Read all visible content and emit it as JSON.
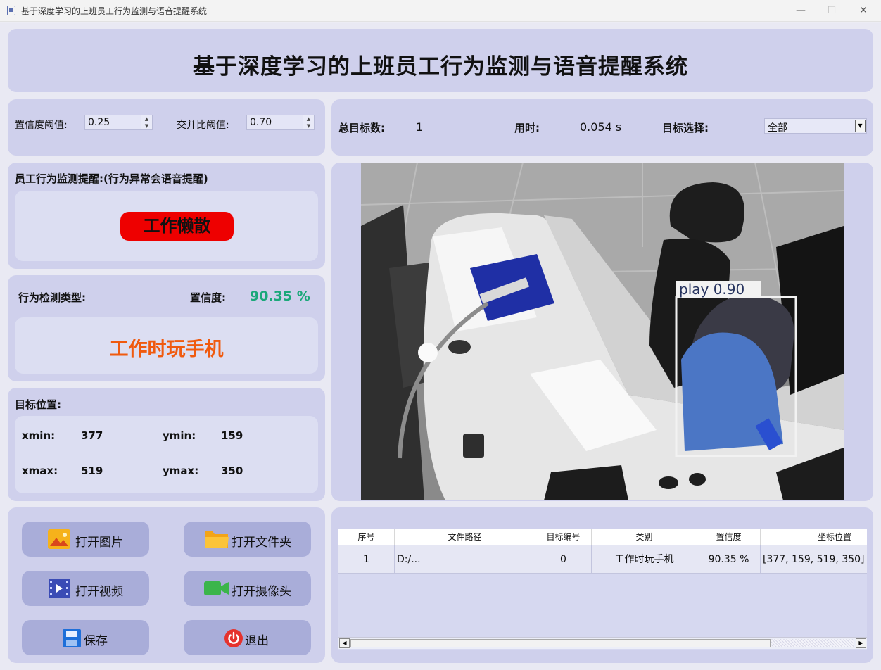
{
  "window": {
    "title": "基于深度学习的上班员工行为监测与语音提醒系统",
    "minimize": "—",
    "maximize": "☐",
    "close": "✕"
  },
  "header": {
    "title": "基于深度学习的上班员工行为监测与语音提醒系统"
  },
  "params": {
    "conf_label": "置信度阈值:",
    "conf_value": "0.25",
    "iou_label": "交并比阈值:",
    "iou_value": "0.70"
  },
  "stats": {
    "total_label": "总目标数:",
    "total_value": "1",
    "time_label": "用时:",
    "time_value": "0.054 s",
    "select_label": "目标选择:",
    "select_value": "全部"
  },
  "alert": {
    "heading": "员工行为监测提醒:(行为异常会语音提醒)",
    "status": "工作懒散",
    "status_color": "#ee0000"
  },
  "detection": {
    "type_label": "行为检测类型:",
    "conf_label": "置信度:",
    "conf_value": "90.35 %",
    "type_value": "工作时玩手机",
    "type_color": "#f05a0f",
    "conf_color": "#1aa87a"
  },
  "position": {
    "heading": "目标位置:",
    "xmin_label": "xmin:",
    "xmin": "377",
    "ymin_label": "ymin:",
    "ymin": "159",
    "xmax_label": "xmax:",
    "xmax": "519",
    "ymax_label": "ymax:",
    "ymax": "350"
  },
  "image": {
    "box_label": "play  0.90"
  },
  "buttons": {
    "open_image": "打开图片",
    "open_folder": "打开文件夹",
    "open_video": "打开视频",
    "open_camera": "打开摄像头",
    "save": "保存",
    "exit": "退出"
  },
  "table": {
    "headers": [
      "序号",
      "文件路径",
      "目标编号",
      "类别",
      "置信度",
      "坐标位置"
    ],
    "rows": [
      [
        "1",
        "D:/...",
        "0",
        "工作时玩手机",
        "90.35 %",
        "[377, 159, 519, 350]"
      ]
    ]
  }
}
